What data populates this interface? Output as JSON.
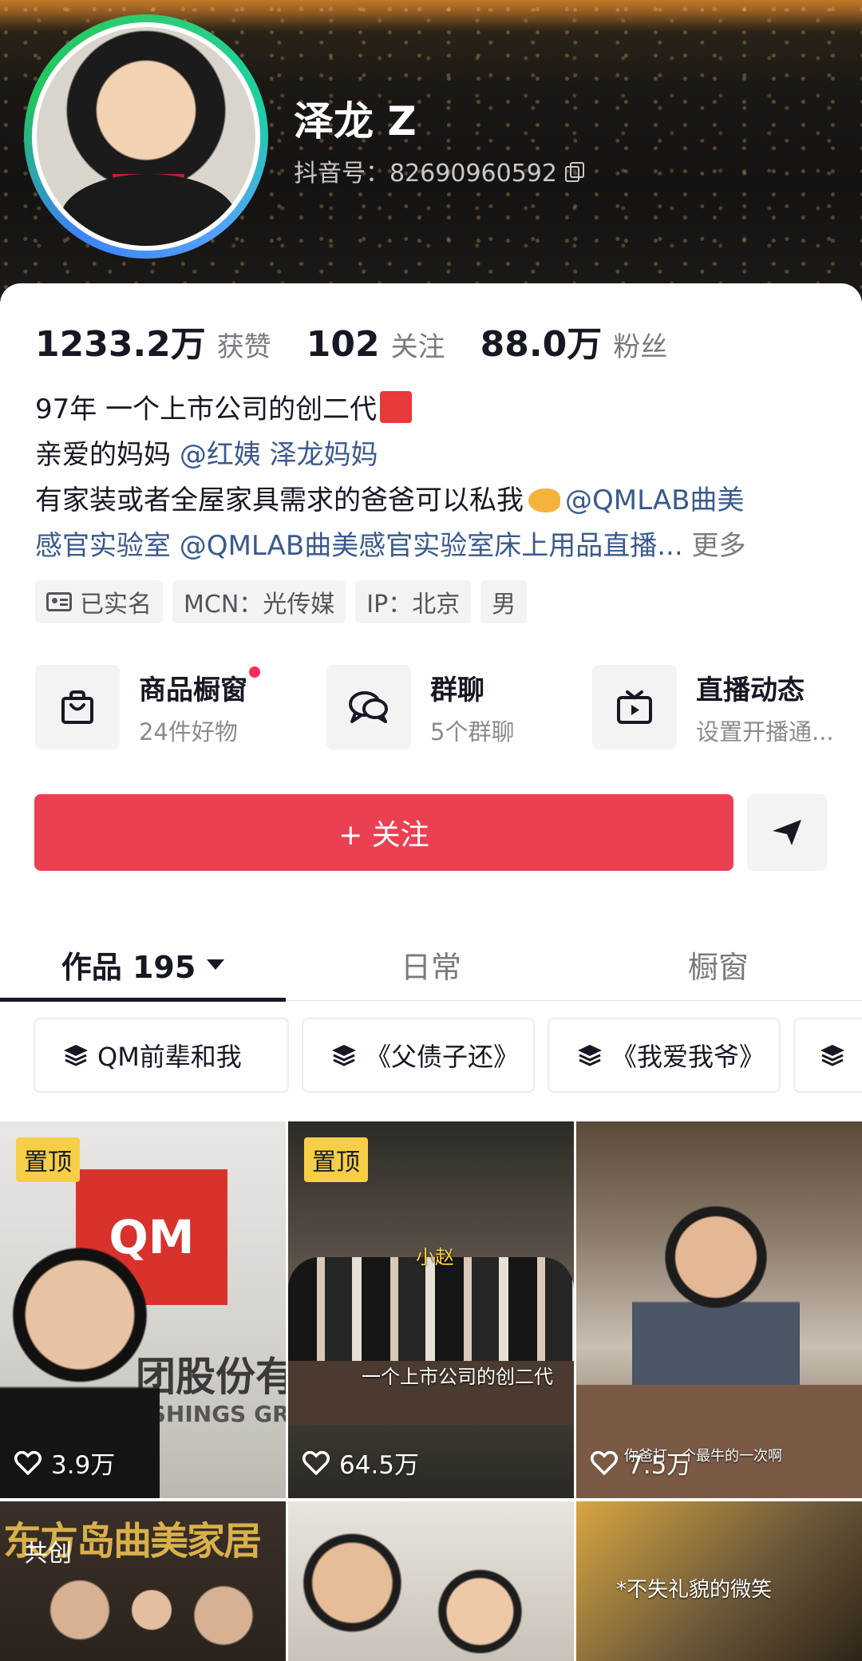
{
  "profile": {
    "name": "泽龙 Z",
    "douyin_id_label": "抖音号：82690960592"
  },
  "stats": [
    {
      "num": "1233.2万",
      "label": "获赞"
    },
    {
      "num": "102",
      "label": "关注"
    },
    {
      "num": "88.0万",
      "label": "粉丝"
    }
  ],
  "bio": {
    "line1": "97年 一个上市公司的创二代",
    "line2_text": "亲爱的妈妈 ",
    "line2_link1": "@红姨",
    "line2_link2": "泽龙妈妈",
    "line3_text": "有家装或者全屋家具需求的爸爸可以私我",
    "line3_link": "@QMLAB曲美",
    "line4_link": "感官实验室 @QMLAB曲美感官实验室床上用品直播...",
    "more": "更多"
  },
  "tags": [
    "已实名",
    "MCN：光传媒",
    "IP：北京",
    "男"
  ],
  "services": [
    {
      "title": "商品橱窗",
      "sub": "24件好物",
      "icon": "bag-icon"
    },
    {
      "title": "群聊",
      "sub": "5个群聊",
      "icon": "chat-icon"
    },
    {
      "title": "直播动态",
      "sub": "设置开播通...",
      "icon": "tv-icon"
    }
  ],
  "actions": {
    "follow": "+ 关注"
  },
  "tabs": [
    {
      "label": "作品 195"
    },
    {
      "label": "日常"
    },
    {
      "label": "橱窗"
    }
  ],
  "collections": [
    "QM前辈和我",
    "《父债子还》",
    "《我爱我爷》"
  ],
  "videos": [
    {
      "pin": "置顶",
      "likes": "3.9万",
      "sign": "QM",
      "sign2": "团股份有",
      "sign3": "USHINGS GROU"
    },
    {
      "pin": "置顶",
      "likes": "64.5万",
      "caption": "一个上市公司的创二代",
      "caption2": "小赵"
    },
    {
      "likes": "7.5万",
      "caption": "你爸打一个最牛的一次啊"
    },
    {
      "cocreate": "共创",
      "banner": "东方岛曲美家居"
    },
    {},
    {
      "caption": "*不失礼貌的微笑"
    }
  ],
  "colors": {
    "primary_red": "#ea4052",
    "link_blue": "#3a5a8c",
    "pin_yellow": "#f6cf47"
  }
}
